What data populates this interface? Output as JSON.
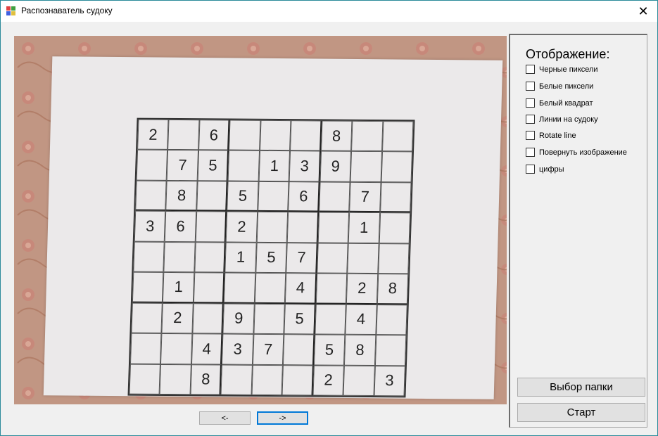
{
  "window": {
    "title": "Распознаватель судоку",
    "close_glyph": "✕"
  },
  "photo": {
    "grid": [
      [
        "2",
        "",
        "6",
        "",
        "",
        "",
        "8",
        "",
        ""
      ],
      [
        "",
        "7",
        "5",
        "",
        "1",
        "3",
        "9",
        "",
        ""
      ],
      [
        "",
        "8",
        "",
        "5",
        "",
        "6",
        "",
        "7",
        ""
      ],
      [
        "3",
        "6",
        "",
        "2",
        "",
        "",
        "",
        "1",
        ""
      ],
      [
        "",
        "",
        "",
        "1",
        "5",
        "7",
        "",
        "",
        ""
      ],
      [
        "",
        "1",
        "",
        "",
        "",
        "4",
        "",
        "2",
        "8"
      ],
      [
        "",
        "2",
        "",
        "9",
        "",
        "5",
        "",
        "4",
        ""
      ],
      [
        "",
        "",
        "4",
        "3",
        "7",
        "",
        "5",
        "8",
        ""
      ],
      [
        "",
        "",
        "8",
        "",
        "",
        "",
        "2",
        "",
        "3"
      ]
    ]
  },
  "nav": {
    "prev_label": "<-",
    "next_label": "->"
  },
  "panel": {
    "title": "Отображение:",
    "checkboxes": [
      {
        "label": "Черные пиксели",
        "checked": false
      },
      {
        "label": "Белые пиксели",
        "checked": false
      },
      {
        "label": "Белый квадрат",
        "checked": false
      },
      {
        "label": "Линии на судоку",
        "checked": false
      },
      {
        "label": "Rotate line",
        "checked": false
      },
      {
        "label": "Повернуть изображение",
        "checked": false
      },
      {
        "label": "цифры",
        "checked": false
      }
    ],
    "folder_button": "Выбор папки",
    "start_button": "Старт"
  }
}
